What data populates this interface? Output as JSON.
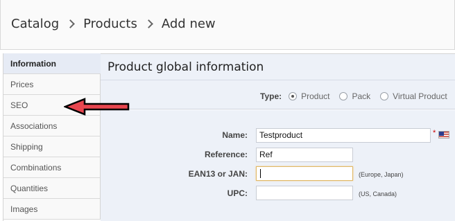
{
  "breadcrumb": {
    "items": [
      "Catalog",
      "Products",
      "Add new"
    ]
  },
  "sidebar": {
    "items": [
      {
        "label": "Information",
        "active": true
      },
      {
        "label": "Prices"
      },
      {
        "label": "SEO"
      },
      {
        "label": "Associations"
      },
      {
        "label": "Shipping"
      },
      {
        "label": "Combinations"
      },
      {
        "label": "Quantities"
      },
      {
        "label": "Images"
      }
    ]
  },
  "main": {
    "title": "Product global information",
    "type": {
      "label": "Type:",
      "options": [
        {
          "label": "Product",
          "selected": true
        },
        {
          "label": "Pack",
          "selected": false
        },
        {
          "label": "Virtual Product",
          "selected": false
        }
      ]
    },
    "fields": {
      "name": {
        "label": "Name:",
        "value": "Testproduct",
        "required_mark": "*",
        "flag_icon": "us-flag-icon"
      },
      "reference": {
        "label": "Reference:",
        "value": "Ref"
      },
      "ean13": {
        "label": "EAN13 or JAN:",
        "value": "",
        "hint": "(Europe, Japan)"
      },
      "upc": {
        "label": "UPC:",
        "value": "",
        "hint": "(US, Canada)"
      }
    }
  },
  "colors": {
    "panel_bg": "#edf1f8",
    "active_tab_bg": "#e6ebf5",
    "arrow_red": "#e8464f",
    "focus_border": "#e0b865"
  }
}
